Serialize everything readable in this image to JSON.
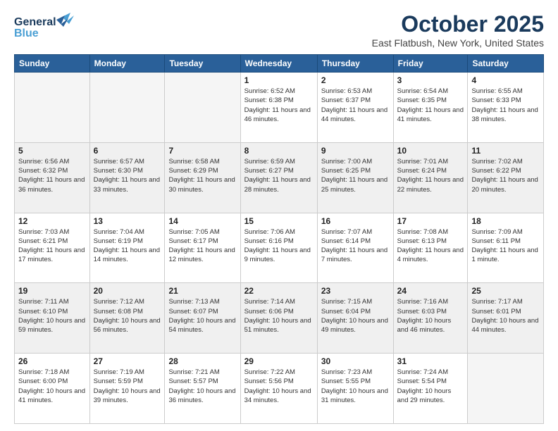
{
  "header": {
    "logo_line1": "General",
    "logo_line2": "Blue",
    "month": "October 2025",
    "location": "East Flatbush, New York, United States"
  },
  "weekdays": [
    "Sunday",
    "Monday",
    "Tuesday",
    "Wednesday",
    "Thursday",
    "Friday",
    "Saturday"
  ],
  "weeks": [
    [
      {
        "day": "",
        "info": ""
      },
      {
        "day": "",
        "info": ""
      },
      {
        "day": "",
        "info": ""
      },
      {
        "day": "1",
        "info": "Sunrise: 6:52 AM\nSunset: 6:38 PM\nDaylight: 11 hours\nand 46 minutes."
      },
      {
        "day": "2",
        "info": "Sunrise: 6:53 AM\nSunset: 6:37 PM\nDaylight: 11 hours\nand 44 minutes."
      },
      {
        "day": "3",
        "info": "Sunrise: 6:54 AM\nSunset: 6:35 PM\nDaylight: 11 hours\nand 41 minutes."
      },
      {
        "day": "4",
        "info": "Sunrise: 6:55 AM\nSunset: 6:33 PM\nDaylight: 11 hours\nand 38 minutes."
      }
    ],
    [
      {
        "day": "5",
        "info": "Sunrise: 6:56 AM\nSunset: 6:32 PM\nDaylight: 11 hours\nand 36 minutes."
      },
      {
        "day": "6",
        "info": "Sunrise: 6:57 AM\nSunset: 6:30 PM\nDaylight: 11 hours\nand 33 minutes."
      },
      {
        "day": "7",
        "info": "Sunrise: 6:58 AM\nSunset: 6:29 PM\nDaylight: 11 hours\nand 30 minutes."
      },
      {
        "day": "8",
        "info": "Sunrise: 6:59 AM\nSunset: 6:27 PM\nDaylight: 11 hours\nand 28 minutes."
      },
      {
        "day": "9",
        "info": "Sunrise: 7:00 AM\nSunset: 6:25 PM\nDaylight: 11 hours\nand 25 minutes."
      },
      {
        "day": "10",
        "info": "Sunrise: 7:01 AM\nSunset: 6:24 PM\nDaylight: 11 hours\nand 22 minutes."
      },
      {
        "day": "11",
        "info": "Sunrise: 7:02 AM\nSunset: 6:22 PM\nDaylight: 11 hours\nand 20 minutes."
      }
    ],
    [
      {
        "day": "12",
        "info": "Sunrise: 7:03 AM\nSunset: 6:21 PM\nDaylight: 11 hours\nand 17 minutes."
      },
      {
        "day": "13",
        "info": "Sunrise: 7:04 AM\nSunset: 6:19 PM\nDaylight: 11 hours\nand 14 minutes."
      },
      {
        "day": "14",
        "info": "Sunrise: 7:05 AM\nSunset: 6:17 PM\nDaylight: 11 hours\nand 12 minutes."
      },
      {
        "day": "15",
        "info": "Sunrise: 7:06 AM\nSunset: 6:16 PM\nDaylight: 11 hours\nand 9 minutes."
      },
      {
        "day": "16",
        "info": "Sunrise: 7:07 AM\nSunset: 6:14 PM\nDaylight: 11 hours\nand 7 minutes."
      },
      {
        "day": "17",
        "info": "Sunrise: 7:08 AM\nSunset: 6:13 PM\nDaylight: 11 hours\nand 4 minutes."
      },
      {
        "day": "18",
        "info": "Sunrise: 7:09 AM\nSunset: 6:11 PM\nDaylight: 11 hours\nand 1 minute."
      }
    ],
    [
      {
        "day": "19",
        "info": "Sunrise: 7:11 AM\nSunset: 6:10 PM\nDaylight: 10 hours\nand 59 minutes."
      },
      {
        "day": "20",
        "info": "Sunrise: 7:12 AM\nSunset: 6:08 PM\nDaylight: 10 hours\nand 56 minutes."
      },
      {
        "day": "21",
        "info": "Sunrise: 7:13 AM\nSunset: 6:07 PM\nDaylight: 10 hours\nand 54 minutes."
      },
      {
        "day": "22",
        "info": "Sunrise: 7:14 AM\nSunset: 6:06 PM\nDaylight: 10 hours\nand 51 minutes."
      },
      {
        "day": "23",
        "info": "Sunrise: 7:15 AM\nSunset: 6:04 PM\nDaylight: 10 hours\nand 49 minutes."
      },
      {
        "day": "24",
        "info": "Sunrise: 7:16 AM\nSunset: 6:03 PM\nDaylight: 10 hours\nand 46 minutes."
      },
      {
        "day": "25",
        "info": "Sunrise: 7:17 AM\nSunset: 6:01 PM\nDaylight: 10 hours\nand 44 minutes."
      }
    ],
    [
      {
        "day": "26",
        "info": "Sunrise: 7:18 AM\nSunset: 6:00 PM\nDaylight: 10 hours\nand 41 minutes."
      },
      {
        "day": "27",
        "info": "Sunrise: 7:19 AM\nSunset: 5:59 PM\nDaylight: 10 hours\nand 39 minutes."
      },
      {
        "day": "28",
        "info": "Sunrise: 7:21 AM\nSunset: 5:57 PM\nDaylight: 10 hours\nand 36 minutes."
      },
      {
        "day": "29",
        "info": "Sunrise: 7:22 AM\nSunset: 5:56 PM\nDaylight: 10 hours\nand 34 minutes."
      },
      {
        "day": "30",
        "info": "Sunrise: 7:23 AM\nSunset: 5:55 PM\nDaylight: 10 hours\nand 31 minutes."
      },
      {
        "day": "31",
        "info": "Sunrise: 7:24 AM\nSunset: 5:54 PM\nDaylight: 10 hours\nand 29 minutes."
      },
      {
        "day": "",
        "info": ""
      }
    ]
  ]
}
